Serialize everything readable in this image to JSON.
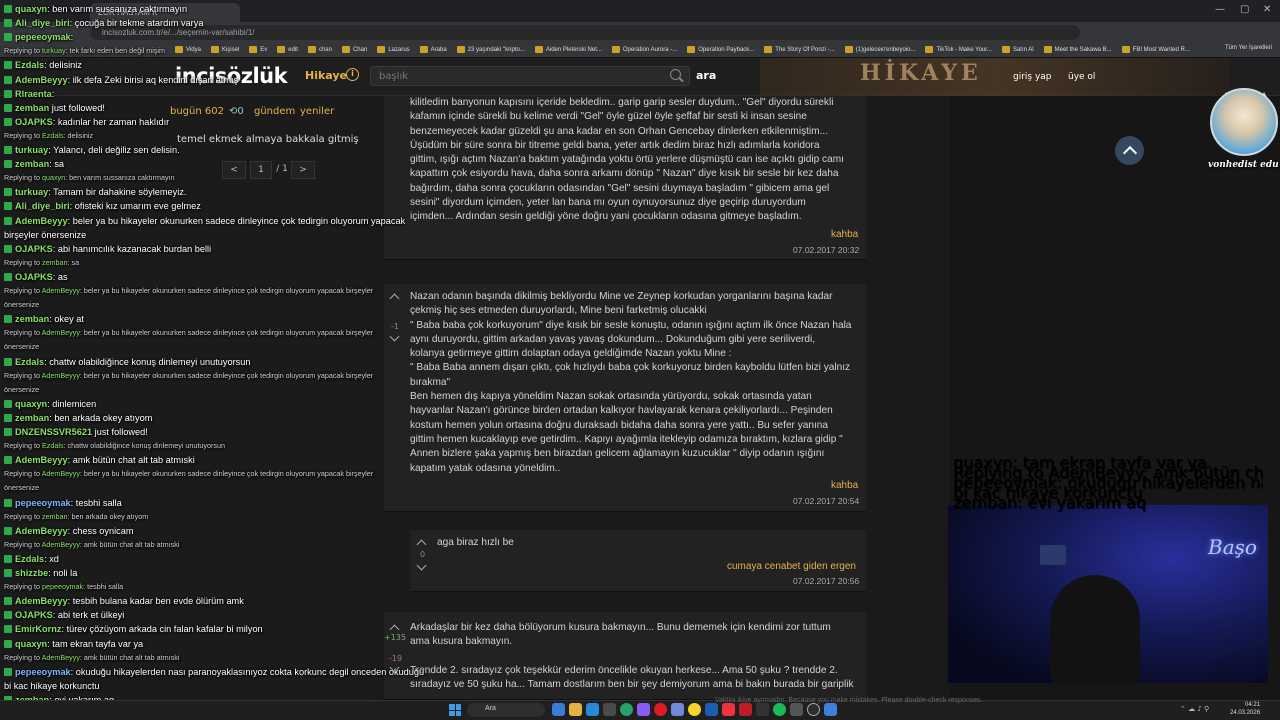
{
  "browser": {
    "tab_title": "ZOR HASTAM K",
    "url": "incisozluk.com.tr/e/.../seçemin-var/sahibi/1/",
    "bookmarks": [
      "Vidya",
      "Kişisel",
      "Ev",
      "edit",
      "chan",
      "Chan",
      "Lazarus",
      "Araba",
      "23 yaşındaki \"kripto...",
      "Aiden Pleterski Net...",
      "Operation Aurora -...",
      "Operation Payback...",
      "The Story Of Ponzi -...",
      "(1)geleceктenbeyoio...",
      "TikTok - Make Your...",
      "Satın Al",
      "Meet the Sakawa B...",
      "FBI Most Wanted R..."
    ],
    "bookmarks_right": "Tüm Yer İşaretleri"
  },
  "site": {
    "logo": "incisözlük",
    "section": "Hikaye",
    "search_placeholder": "başlık",
    "search_button": "ara",
    "login": "giriş yap",
    "signup": "üye ol",
    "banner": "HİKAYE"
  },
  "left_nav": {
    "today": "bugün 602",
    "today_badge": "0",
    "agenda": "gündem",
    "new": "yeniler",
    "topic_title": "temel ekmek almaya bakkala gitmiş",
    "page_current": "1",
    "page_total": "/ 1",
    "prev": "<",
    "next": ">"
  },
  "entries": [
    {
      "lines": [
        "kilitledim banyonun kapısını içeride bekledim.. garip garip sesler duydum.. \"Gel\" diyordu sürekli",
        "kafamın içinde sürekli bu kelime verdi \"Gel\" öyle güzel öyle şeffaf bir sesti ki insan sesine",
        "benzemeyecek kadar güzeldi şu ana kadar en son Orhan Gencebay dinlerken etkilenmiştim...",
        "Üşüdüm bir süre sonra bir titreme geldi bana, yeter artık dedim biraz hızlı adımlarla koridora",
        "gittim, ışığı açtım Nazan'a baktım yatağında yoktu örtü yerlere düşmüştü can ise açıktı gidip camı",
        "kapattım çok esiyordu hava, daha sonra arkamı dönüp \" Nazan\" diye kısık bir sesle bir kez daha",
        "bağırdım, daha sonra çocukların odasından \"Gel\" sesini duymaya başladım \" gibicem ama gel",
        "sesini\" diyordum içimden, yeter lan bana mı oyun oynuyorsunuz diye geçirip duruyordum",
        "içimden... Ardından sesin geldiği yöne doğru yani çocukların odasına gitmeye başladım."
      ],
      "author": "kahba",
      "date": "07.02.2017 20:32"
    },
    {
      "vote": "-1",
      "lines": [
        "Nazan odanın başında dikilmiş bekliyordu Mine ve Zeynep korkudan yorganlarını başına kadar",
        "çekmiş hiç ses etmeden duruyorlardı, Mine beni farketmiş olucakki",
        "\" Baba baba çok korkuyorum\" diye kısık bir sesle konuştu, odanın ışığını açtım ilk önce Nazan hala",
        "aynı duruyordu, gittim arkadan yavaş yavaş dokundum... Dokunduğum gibi yere seriliverdi,",
        "kolanya getirmeye gittim dolaptan odaya geldiğimde Nazan yoktu Mine :",
        "\" Baba Baba annem dışarı çıktı, çok hızlıydı baba çok korkuyoruz birden kayboldu lütfen bizi yalnız",
        "bırakma\"",
        "Ben hemen dış kapıya yöneldim Nazan sokak ortasında yürüyordu, sokak ortasında yatan",
        "hayvanlar Nazan'ı görünce birden ortadan kalkıyor havlayarak kenara çekiliyorlardı... Peşinden",
        "kostum hemen yolun ortasına doğru duraksadı bidaha daha sonra yere yattı.. Bu sefer yanına",
        "gittim hemen kucaklayıp eve getirdim.. Kapıyı ayağımla itekleyip odamıza bıraktım, kızlara gidip \"",
        "Annen bizlere şaka yapmış ben birazdan gelicem ağlamayın kuzucuklar \" diyip odanın ışığını",
        "kapatım yatak odasına yöneldim.."
      ],
      "author": "kahba",
      "date": "07.02.2017 20:54"
    },
    {
      "vote": "0",
      "lines": [
        "aga biraz hızlı be"
      ],
      "author": "cumaya cenabet giden ergen",
      "date": "07.02.2017 20:56"
    },
    {
      "vote_up": "+135",
      "vote_down": "-19",
      "lines": [
        "Arkadaşlar bir kez daha bölüyorum kusura bakmayın... Bunu dememek için kendimi zor tuttum",
        "ama kusura bakmayın.",
        "",
        "Trendde 2. sıradayız çok teşekkür ederim öncelikle okuyan herkese... Ama 50 şuku ? trendde 2.",
        "sıradayız ve 50 şuku ha... Tamam dostlarım ben bir şey demiyorum ama bi bakın burada bir gariplik"
      ]
    }
  ],
  "chat": [
    {
      "type": "msg",
      "user": "quaxyn",
      "text": ": ben varım sussanıza caktırmayın"
    },
    {
      "type": "msg",
      "user": "Ali_diye_biri",
      "text": ": çocuğa bir tekme atardım varya"
    },
    {
      "type": "msg",
      "user": "pepeeoymak",
      "text": ":"
    },
    {
      "type": "rep",
      "text": "Replying to ",
      "user": "turkuay",
      "rest": ": tek farkı eden ben değil mişim"
    },
    {
      "type": "msg",
      "user": "Ezdals",
      "text": ": delisiniz"
    },
    {
      "type": "msg",
      "user": "AdemBeyyy",
      "text": ": ilk defa Zeki birisi aq kendini dışarı atmış"
    },
    {
      "type": "msg",
      "user": "Rlraenta",
      "text": ":"
    },
    {
      "type": "msg",
      "user": "zemban",
      "text": " just followed!"
    },
    {
      "type": "msg",
      "user": "OJAPKS",
      "text": ": kadınlar her zaman haklıdır"
    },
    {
      "type": "rep",
      "text": "Replying to ",
      "user": "Ezdals",
      "rest": ": delisiniz"
    },
    {
      "type": "msg",
      "user": "turkuay",
      "text": ": Yalancı, deli değiliz sen delisin."
    },
    {
      "type": "msg",
      "user": "zemban",
      "text": ": sa"
    },
    {
      "type": "rep",
      "text": "Replying to ",
      "user": "quaxyn",
      "rest": ": ben varım sussanıza caktırmayın"
    },
    {
      "type": "msg",
      "user": "turkuay",
      "text": ": Tamam bir dahakine söylemeyiz."
    },
    {
      "type": "msg",
      "user": "Ali_diye_biri",
      "text": ": ofisteki kız umarım eve gelmez"
    },
    {
      "type": "msg",
      "user": "AdemBeyyy",
      "text": ": beler ya bu hikayeler okunurken sadece dinleyince çok tedirgin oluyorum yapacak"
    },
    {
      "type": "cont",
      "text": "birşeyler önersenize"
    },
    {
      "type": "msg",
      "user": "OJAPKS",
      "text": ": abi hanımcılık kazanacak burdan belli"
    },
    {
      "type": "rep",
      "text": "Replying to ",
      "user": "zemban",
      "rest": ": sa"
    },
    {
      "type": "msg",
      "user": "OJAPKS",
      "text": ": as"
    },
    {
      "type": "rep",
      "text": "Replying to ",
      "user": "AdemBeyyy",
      "rest": ": beler ya bu hikayeler okunurken sadece dinleyince çok tedirgin oluyorum yapacak birşeyler"
    },
    {
      "type": "repcont",
      "text": "önersenize"
    },
    {
      "type": "msg",
      "user": "zemban",
      "text": ": okey at"
    },
    {
      "type": "rep",
      "text": "Replying to ",
      "user": "AdemBeyyy",
      "rest": ": beler ya bu hikayeler okunurken sadece dinleyince çok tedirgin oluyorum yapacak birşeyler"
    },
    {
      "type": "repcont",
      "text": "önersenize"
    },
    {
      "type": "msg",
      "user": "Ezdals",
      "text": ": chattw olabildiğince konuş dinlemeyi unutuyorsun"
    },
    {
      "type": "rep",
      "text": "Replying to ",
      "user": "AdemBeyyy",
      "rest": ": beler ya bu hikayeler okunurken sadece dinleyince çok tedirgin oluyorum yapacak birşeyler"
    },
    {
      "type": "repcont",
      "text": "önersenize"
    },
    {
      "type": "msg",
      "user": "quaxyn",
      "text": ": dinlemicen"
    },
    {
      "type": "msg",
      "user": "zemban",
      "text": ": ben arkada okey atıyom"
    },
    {
      "type": "msg",
      "user": "DNZENSSVR5621",
      "text": " just followed!"
    },
    {
      "type": "rep",
      "text": "Replying to ",
      "user": "Ezdals",
      "rest": ": chattw olabildiğince konuş dinlemeyi unutuyorsun"
    },
    {
      "type": "msg",
      "user": "AdemBeyyy",
      "text": ": amk bütün chat alt tab atmıski"
    },
    {
      "type": "rep",
      "text": "Replying to ",
      "user": "AdemBeyyy",
      "rest": ": beler ya bu hikayeler okunurken sadece dinleyince çok tedirgin oluyorum yapacak birşeyler"
    },
    {
      "type": "repcont",
      "text": "önersenize"
    },
    {
      "type": "msg",
      "user": "pepeeoymak",
      "text": ": tesbhi salla",
      "blue": true
    },
    {
      "type": "rep",
      "text": "Replying to ",
      "user": "zemban",
      "rest": ": ben arkada okey atıyom"
    },
    {
      "type": "msg",
      "user": "AdemBeyyy",
      "text": ": chess oynicam"
    },
    {
      "type": "rep",
      "text": "Replying to ",
      "user": "AdemBeyyy",
      "rest": ": amk bütün chat alt tab atmıski"
    },
    {
      "type": "msg",
      "user": "Ezdals",
      "text": ": xd"
    },
    {
      "type": "msg",
      "user": "shizzbe",
      "text": ": noli la"
    },
    {
      "type": "rep",
      "text": "Replying to ",
      "user": "pepeeoymak",
      "rest": ": tesbhi salla"
    },
    {
      "type": "msg",
      "user": "AdemBeyyy",
      "text": ": tesbih bulana kadar ben evde ölürüm amk"
    },
    {
      "type": "msg",
      "user": "OJAPKS",
      "text": ": abi terk et ülkeyi"
    },
    {
      "type": "msg",
      "user": "EmirKornz",
      "text": ": türev çözüyom arkada cin falan kafalar bi milyon"
    },
    {
      "type": "msg",
      "user": "quaxyn",
      "text": ": tam ekran tayfa var ya"
    },
    {
      "type": "rep",
      "text": "Replying to ",
      "user": "AdemBeyyy",
      "rest": ": amk bütün chat alt tab atmıski"
    },
    {
      "type": "msg",
      "user": "pepeeoymak",
      "text": ": okuduğu hikayelerden nası paranoyaklasınıyoz cokta korkunc degil onceden okuduğu",
      "blue": true
    },
    {
      "type": "cont",
      "text": "bi kac hikaye korkunctu"
    },
    {
      "type": "msg",
      "user": "zemban",
      "text": ": evi yakarım aq"
    }
  ],
  "mini_chat": [
    {
      "type": "msg",
      "user": "quaxyn",
      "text": ": tam ekran tayfa var ya"
    },
    {
      "type": "rep",
      "text": "Replying to AdemBeyyy: amk bütün chat alt tab atmıski"
    },
    {
      "type": "msg",
      "user": "pepeeoymak",
      "text": ": okuduğu hikayelerden nası paranoyaklasınıyoz cokta korkunc degil onceden okuduğu"
    },
    {
      "type": "cont",
      "text": "bi kac hikaye korkunctu"
    },
    {
      "type": "msg",
      "user": "zemban",
      "text": ": evi yakarım aq"
    }
  ],
  "stream": {
    "neon_sign": "Başo",
    "avatar_name": "vonhedist edu"
  },
  "taskbar": {
    "search": "Ara",
    "time": "04:21",
    "date": "24.03.2026",
    "caption": "Vaktini ikiye ayırmadın. Because you make mistakes. Please double-check responses."
  }
}
